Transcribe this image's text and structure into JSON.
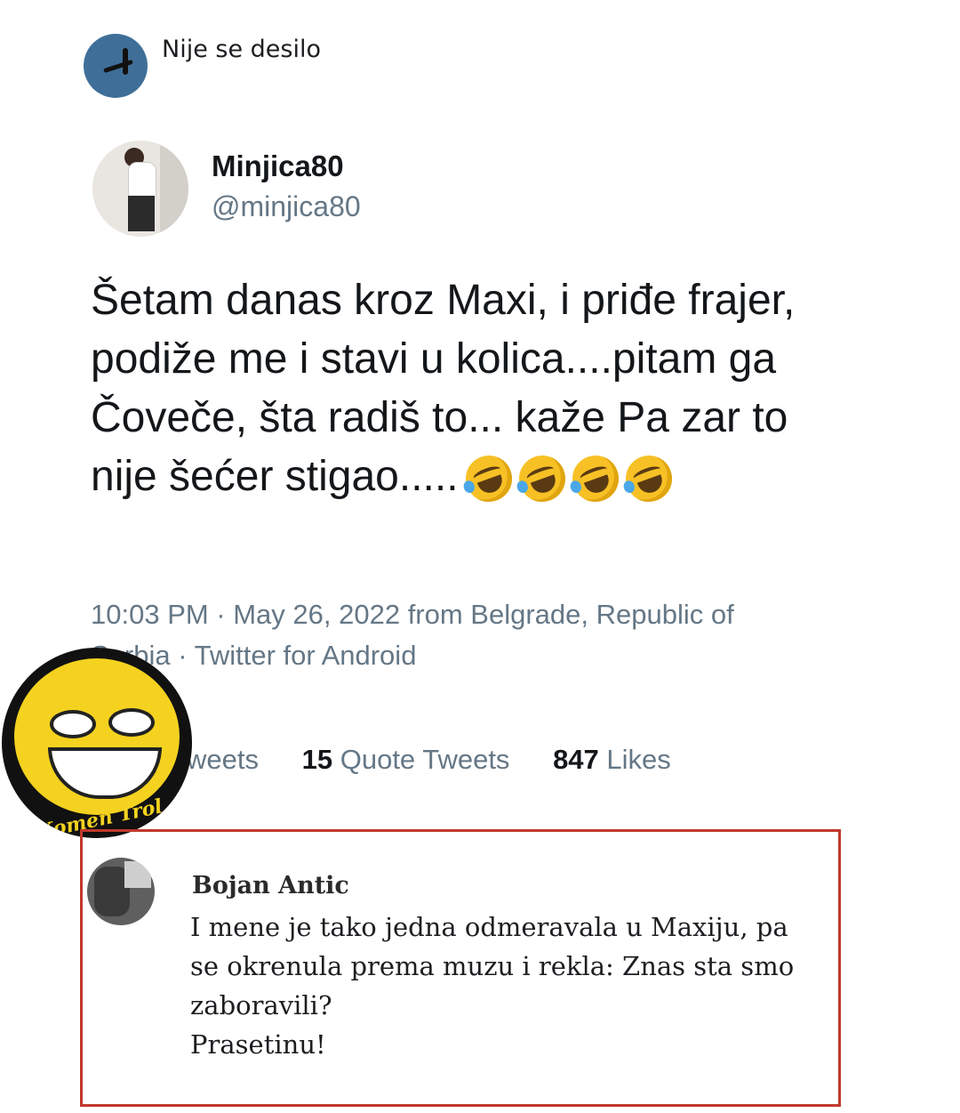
{
  "post": {
    "page_name": "Nije se desilo",
    "icon": "page-avatar"
  },
  "tweet": {
    "display_name": "Minjica80",
    "handle": "@minjica80",
    "text": "Šetam danas kroz Maxi, i priđe frajer, podiže me i stavi u kolica....pitam ga Čoveče, šta radiš to... kaže Pa zar to nije šećer stigao.....",
    "emoji": [
      "rolling-on-floor-laughing-icon",
      "rolling-on-floor-laughing-icon",
      "rolling-on-floor-laughing-icon",
      "rolling-on-floor-laughing-icon"
    ],
    "meta_line1": "10:03 PM · May 26, 2022 from Belgrade, Republic of",
    "meta_line2": "Serbia · Twitter for Android",
    "retweets_label": "weets",
    "quote_count": "15",
    "quote_label": "Quote Tweets",
    "likes_count": "847",
    "likes_label": "Likes"
  },
  "watermark": {
    "brand": "Komen Trol"
  },
  "reply": {
    "name": "Bojan Antic",
    "lines": [
      "I mene je tako jedna odmeravala u Maxiju, pa",
      "se okrenula prema muzu i rekla: Znas sta smo",
      "zaboravili?",
      "Prasetinu!"
    ],
    "border_color": "#c0392b"
  }
}
